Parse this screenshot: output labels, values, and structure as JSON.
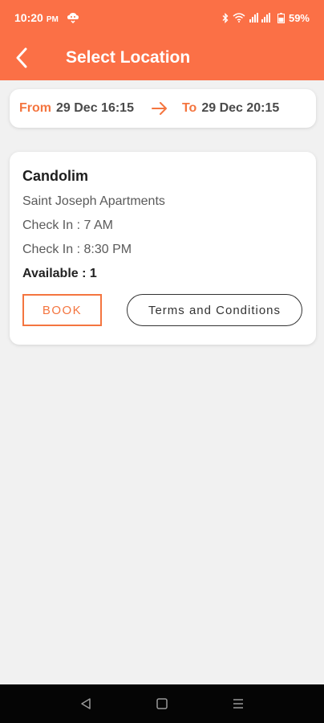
{
  "status_bar": {
    "time": "10:20",
    "ampm": "PM",
    "battery": "59%",
    "icons": [
      "app-notification-icon",
      "bluetooth-icon",
      "wifi-icon",
      "signal-icon",
      "battery-icon"
    ]
  },
  "app_bar": {
    "title": "Select Location",
    "back_icon": "back-arrow-icon"
  },
  "route": {
    "from_label": "From",
    "from_value": "29 Dec 16:15",
    "to_label": "To",
    "to_value": "29 Dec 20:15",
    "arrow_icon": "arrow-right-icon"
  },
  "location": {
    "name": "Candolim",
    "place": "Saint Joseph Apartments",
    "check_in": "Check In : 7 AM",
    "check_out": "Check In :  8:30 PM",
    "available": "Available : 1",
    "book_label": "BOOK",
    "terms_label": "Terms and Conditions"
  },
  "nav_bar": {
    "icons": [
      "back-triangle-icon",
      "home-square-icon",
      "recents-menu-icon"
    ]
  },
  "colors": {
    "accent": "#fb7046",
    "label_orange": "#f4753f",
    "background": "#f1f1f1"
  }
}
